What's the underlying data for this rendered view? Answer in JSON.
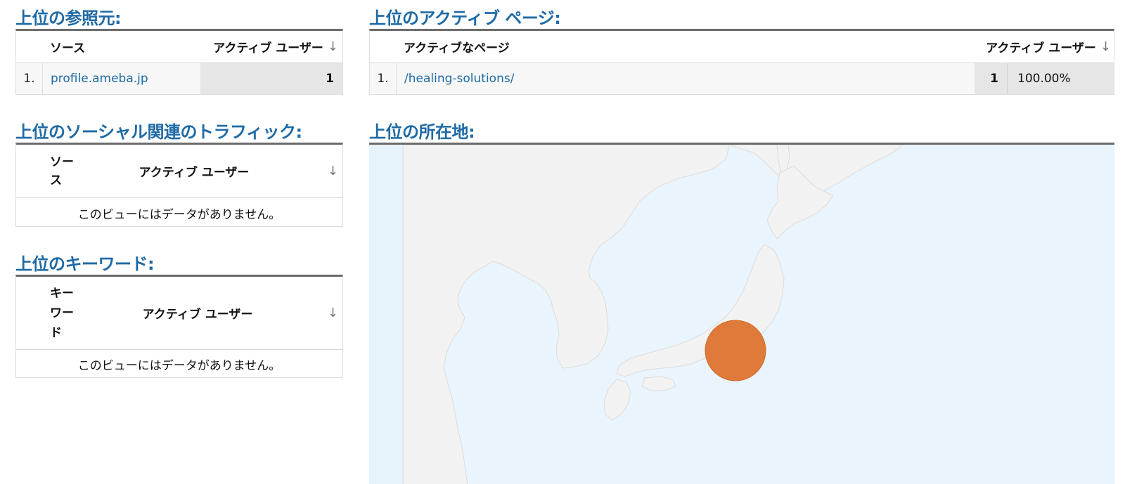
{
  "referrers": {
    "title": "上位の参照元:",
    "col_source": "ソース",
    "col_users": "アクティブ ユーザー",
    "rows": [
      {
        "index": "1.",
        "source": "profile.ameba.jp",
        "users": "1"
      }
    ]
  },
  "active_pages": {
    "title": "上位のアクティブ ページ:",
    "col_page": "アクティブなページ",
    "col_users": "アクティブ ユーザー",
    "rows": [
      {
        "index": "1.",
        "page": "/healing-solutions/",
        "users": "1",
        "percent": "100.00%"
      }
    ]
  },
  "social": {
    "title": "上位のソーシャル関連のトラフィック:",
    "col_source_line1": "ソー",
    "col_source_line2": "ス",
    "col_users": "アクティブ ユーザー",
    "no_data": "このビューにはデータがありません。"
  },
  "keywords": {
    "title": "上位のキーワード:",
    "col_keyword_line1": "キー",
    "col_keyword_line2": "ワー",
    "col_keyword_line3": "ド",
    "col_users": "アクティブ ユーザー",
    "no_data": "このビューにはデータがありません。"
  },
  "locations": {
    "title": "上位の所在地:",
    "marker_color": "#e07a3a",
    "sea_color": "#e9f4fc",
    "land_color": "#f2f2f2"
  },
  "icons": {
    "sort_arrow": "↓"
  }
}
